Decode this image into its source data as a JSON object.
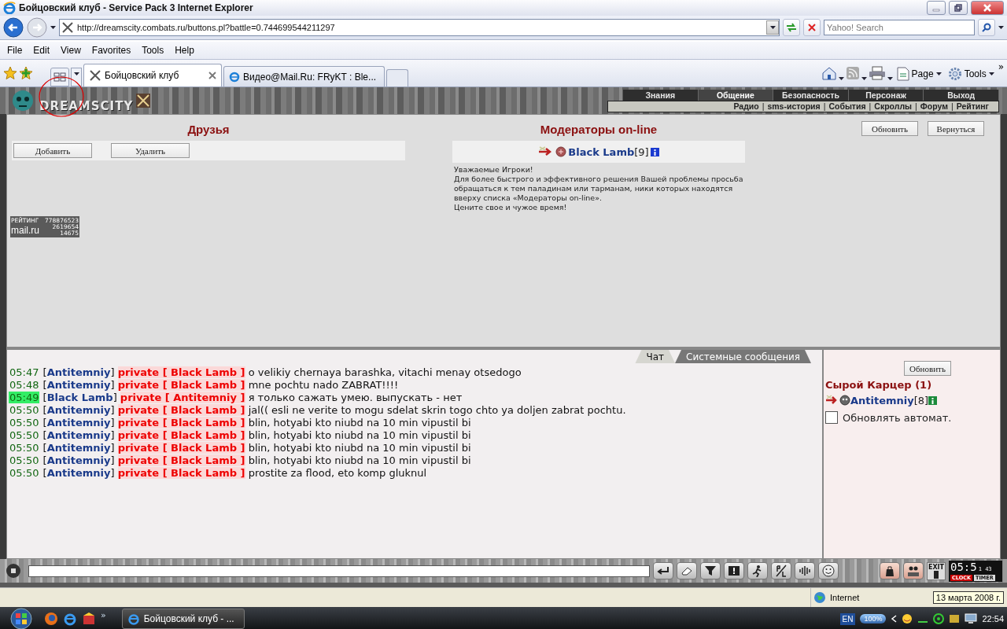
{
  "window": {
    "title": "Бойцовский клуб - Service Pack 3 Internet Explorer"
  },
  "address_bar": {
    "url": "http://dreamscity.combats.ru/buttons.pl?battle=0.744699544211297"
  },
  "search": {
    "placeholder": "Yahoo! Search"
  },
  "menu": [
    "File",
    "Edit",
    "View",
    "Favorites",
    "Tools",
    "Help"
  ],
  "tabs": [
    {
      "label": "Бойцовский клуб",
      "selected": true
    },
    {
      "label": "Видео@Mail.Ru: FRyKT : Ble...",
      "selected": false
    }
  ],
  "command_bar": {
    "items": [
      "Page",
      "Tools"
    ],
    "more": "»"
  },
  "game_header": {
    "logo": "DREAMSCITY",
    "nav": [
      {
        "label": "Знания",
        "selected": false
      },
      {
        "label": "Общение",
        "selected": true
      },
      {
        "label": "Безопасность",
        "selected": false
      },
      {
        "label": "Персонаж",
        "selected": false
      },
      {
        "label": "Выход",
        "selected": false
      }
    ],
    "subnav": [
      "Радио",
      "sms-история",
      "События",
      "Скроллы",
      "Форум",
      "Рейтинг"
    ],
    "separator": "|"
  },
  "friends": {
    "title": "Друзья",
    "buttons": [
      "Добавить",
      "Удалить"
    ]
  },
  "counter": {
    "label": "РЕЙТИНГ",
    "rating": "778876523",
    "brand": "mail.ru",
    "hits": "2619654",
    "hosts": "14675"
  },
  "moderators": {
    "title": "Модераторы on-line",
    "list": [
      {
        "name": "**Black Lamb**[9]"
      }
    ],
    "notice": [
      "Уважаемые Игроки!",
      "Для более быстрого и эффективного решения Вашей проблемы просьба обращаться к тем паладинам или тарманам, ники которых находятся вверху списка «Модераторы on-line».",
      "Цените свое и чужое время!"
    ]
  },
  "top_buttons": [
    "Обновить",
    "Вернуться"
  ],
  "chat": {
    "tabs": [
      {
        "label": "Чат",
        "selected": true
      },
      {
        "label": "Системные сообщения",
        "selected": false
      }
    ],
    "messages": [
      {
        "time": "05:47",
        "highlighted": false,
        "sender": "[**Antitemniy**]",
        "to": "private [ Black Lamb ]",
        "text": "o velikiy chernaya barashka, vitachi menay otsedogo"
      },
      {
        "time": "05:48",
        "highlighted": false,
        "sender": "[**Antitemniy**]",
        "to": "private [ Black Lamb ]",
        "text": "mne pochtu nado ZABRAT!!!!"
      },
      {
        "time": "05:49",
        "highlighted": true,
        "sender": "[**Black Lamb**]",
        "to": "private [ Antitemniy ]",
        "text": "я только сажать умею. выпускать - нет"
      },
      {
        "time": "05:50",
        "highlighted": false,
        "sender": "[**Antitemniy**]",
        "to": "private [ Black Lamb ]",
        "text": "jal(( esli ne verite to mogu sdelat skrin togo chto ya doljen zabrat pochtu."
      },
      {
        "time": "05:50",
        "highlighted": false,
        "sender": "[**Antitemniy**]",
        "to": "private [ Black Lamb ]",
        "text": "blin, hotyabi kto niubd na 10 min vipustil bi"
      },
      {
        "time": "05:50",
        "highlighted": false,
        "sender": "[**Antitemniy**]",
        "to": "private [ Black Lamb ]",
        "text": "blin, hotyabi kto niubd na 10 min vipustil bi"
      },
      {
        "time": "05:50",
        "highlighted": false,
        "sender": "[**Antitemniy**]",
        "to": "private [ Black Lamb ]",
        "text": "blin, hotyabi kto niubd na 10 min vipustil bi"
      },
      {
        "time": "05:50",
        "highlighted": false,
        "sender": "[**Antitemniy**]",
        "to": "private [ Black Lamb ]",
        "text": "blin, hotyabi kto niubd na 10 min vipustil bi"
      },
      {
        "time": "05:50",
        "highlighted": false,
        "sender": "[**Antitemniy**]",
        "to": "private [ Black Lamb ]",
        "text": "prostite za flood, eto komp gluknul"
      }
    ]
  },
  "jail": {
    "button": "Обновить",
    "title": "Сырой Карцер (1)",
    "users": [
      {
        "name": "**Antitemniy**[8]"
      }
    ],
    "auto_refresh": {
      "label": "Обновлять автомат.",
      "checked": false
    }
  },
  "bottom_bar": {
    "clock": "05:5",
    "seconds": "1 43",
    "exit_label": "EXIT",
    "clock_label": "CLOCK",
    "timer_label": "TIMER"
  },
  "status_bar": {
    "zone": "Internet",
    "tooltip": "13 марта 2008 г."
  },
  "taskbar": {
    "quicklaunch_more": "»",
    "task": "Бойцовский клуб - ...",
    "language": "EN",
    "battery": "100%",
    "time": "22:54"
  }
}
